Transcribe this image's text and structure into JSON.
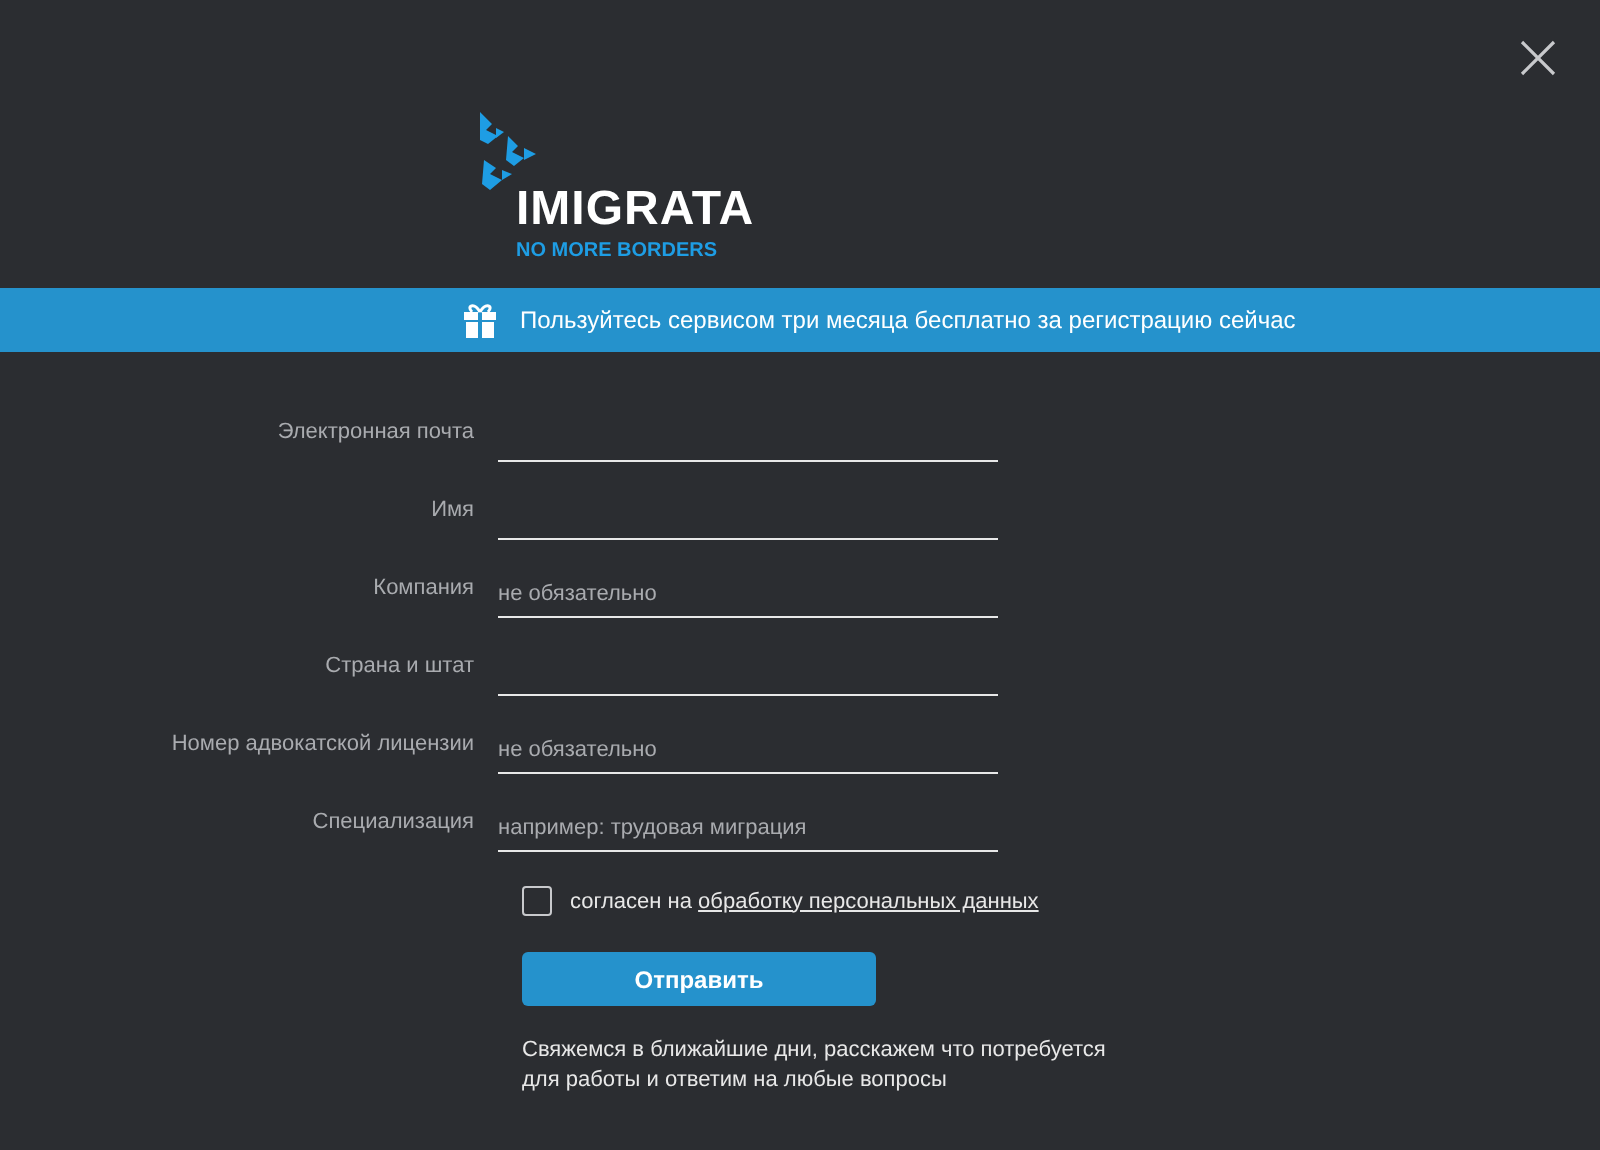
{
  "logo": {
    "name": "IMIGRATA",
    "tagline": "NO MORE BORDERS"
  },
  "banner": {
    "text": "Пользуйтесь сервисом три месяца бесплатно за регистрацию сейчас"
  },
  "fields": [
    {
      "label": "Электронная почта"
    },
    {
      "label": "Имя"
    },
    {
      "label": "Компания",
      "placeholder": "не обязательно"
    },
    {
      "label": "Страна и штат"
    },
    {
      "label": "Номер адвокатской лицензии",
      "placeholder": "не обязательно"
    },
    {
      "label": "Специализация",
      "placeholder": "например: трудовая миграция"
    }
  ],
  "consent": {
    "text": "согласен на",
    "link": "обработку персональных данных",
    "checked": false
  },
  "submit": {
    "label": "Отправить"
  },
  "note": "Свяжемся в ближайшие дни, расскажем что потребуется для работы и ответим на любые вопросы"
}
